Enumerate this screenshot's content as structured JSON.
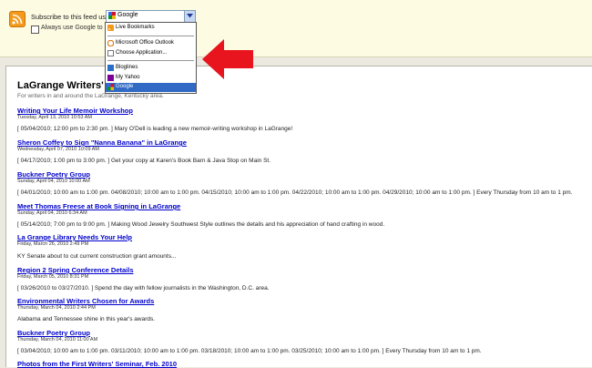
{
  "subscribe": {
    "label": "Subscribe to this feed using",
    "selected": "Google",
    "always_use": "Always use Google to sub"
  },
  "dropdown": {
    "items": [
      {
        "label": "Live Bookmarks"
      },
      {
        "label": "Microsoft Office Outlook"
      },
      {
        "label": "Choose Application..."
      },
      {
        "label": "Bloglines"
      },
      {
        "label": "My Yahoo"
      },
      {
        "label": "Google"
      }
    ]
  },
  "feed": {
    "title": "LaGrange Writers' Se",
    "subtitle": "For writers in and around the LaGrange, Kentucky area.",
    "entries": [
      {
        "title": "Writing Your Life Memoir Workshop",
        "date": "Tuesday, April 13, 2010 10:53 AM",
        "desc": "[ 05/04/2010; 12:00 pm to 2:30 pm. ] Mary O'Dell is leading a new memoir-writing workshop in LaGrange!"
      },
      {
        "title": "Sheron Coffey to Sign \"Nanna Banana\" in LaGrange",
        "date": "Wednesday, April 07, 2010 10:09 AM",
        "desc": "[ 04/17/2010; 1:00 pm to 3:00 pm. ] Get your copy at Karen's Book Barn & Java Stop on Main St."
      },
      {
        "title": "Buckner Poetry Group",
        "date": "Sunday, April 04, 2010 10:00 AM",
        "desc": "[ 04/01/2010; 10:00 am to 1:00 pm. 04/08/2010; 10:00 am to 1:00 pm. 04/15/2010; 10:00 am to 1:00 pm. 04/22/2010; 10:00 am to 1:00 pm. 04/29/2010; 10:00 am to 1:00 pm. ] Every Thursday from 10 am to 1 pm."
      },
      {
        "title": "Meet Thomas Freese at Book Signing in LaGrange",
        "date": "Sunday, April 04, 2010 6:34 AM",
        "desc": "[ 05/14/2010; 7:00 pm to 9:00 pm. ] Making Wood Jewelry Southwest Style outlines the details and his appreciation of hand crafting in wood."
      },
      {
        "title": "La Grange Library Needs Your Help",
        "date": "Friday, March 26, 2010 2:49 PM",
        "desc": "KY Senate about to cut current construction grant amounts..."
      },
      {
        "title": "Region 2 Spring Conference Details",
        "date": "Friday, March 05, 2010 8:31 PM",
        "desc": "[ 03/26/2010 to 03/27/2010. ] Spend the day with fellow journalists in the Washington, D.C. area."
      },
      {
        "title": "Environmental Writers Chosen for Awards",
        "date": "Thursday, March 04, 2010 2:44 PM",
        "desc": "Alabama and Tennessee shine in this year's awards."
      },
      {
        "title": "Buckner Poetry Group",
        "date": "Thursday, March 04, 2010 11:00 AM",
        "desc": "[ 03/04/2010; 10:00 am to 1:00 pm. 03/11/2010; 10:00 am to 1:00 pm. 03/18/2010; 10:00 am to 1:00 pm. 03/25/2010; 10:00 am to 1:00 pm. ] Every Thursday from 10 am to 1 pm."
      },
      {
        "title": "Photos from the First Writers' Seminar, Feb. 2010",
        "date": "",
        "desc": ""
      }
    ]
  },
  "colors": {
    "accent": "#316ac5",
    "link": "#0000cc",
    "arrow": "#e8141e"
  }
}
